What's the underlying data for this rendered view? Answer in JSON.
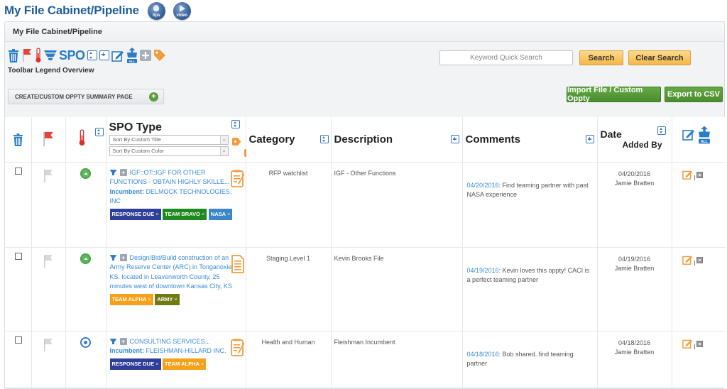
{
  "page": {
    "title": "My File Cabinet/Pipeline",
    "tips_label": "tips",
    "video_label": "video"
  },
  "panel": {
    "title": "My File Cabinet/Pipeline",
    "toolbar": {
      "spo_label": "SPO",
      "legend_label": "Toolbar Legend Overview",
      "icons": [
        "trash-icon",
        "flag-icon",
        "thermometer-icon",
        "funnel-icon",
        "spo-text",
        "sort-icon",
        "plus-icon",
        "edit-icon",
        "share-all-icon",
        "grey-plus-icon",
        "tag-icon"
      ]
    },
    "search": {
      "placeholder": "Keyword Quick Search",
      "value": "",
      "search_label": "Search",
      "clear_label": "Clear Search"
    },
    "create_button_label": "CREATE/CUSTOM OPPTY SUMMARY PAGE",
    "import_label": "Import File / Custom Oppty",
    "export_label": "Export to CSV"
  },
  "table": {
    "headers": {
      "spo_type": "SPO Type",
      "sort_title": "Sort By Custom Title",
      "sort_color": "Sort By Custom Color",
      "category": "Category",
      "description": "Description",
      "comments": "Comments",
      "date": "Date",
      "added_by": "Added By",
      "all_badge": "ALL"
    },
    "rows": [
      {
        "temperature": "up",
        "spo_title": "IGF::OT::IGF FOR OTHER FUNCTIONS - OBTAIN HIGHLY SKILLE...",
        "incumbent_label": "Incumbent:",
        "incumbent": "DELMOCK TECHNOLOGIES, INC",
        "tags": [
          {
            "label": "RESPONSE DUE",
            "color": "#2f3f99"
          },
          {
            "label": "TEAM BRAVO",
            "color": "#1e8a1e"
          },
          {
            "label": "NASA",
            "color": "#3a86c8"
          }
        ],
        "category": "RFP watchlist",
        "description": "IGF - Other Functions",
        "comment_date": "04/20/2016",
        "comment_text": ": Find teaming partner with past NASA experience",
        "date": "04/20/2016",
        "added_by": "Jamie Bratten"
      },
      {
        "temperature": "up",
        "spo_title": "Design/Bid/Build construction of an Army Reserve Center (ARC) in Tonganoxie, KS. located in Leavenworth County, 25 minutes west of downtown Kansas City, KS",
        "incumbent_label": "",
        "incumbent": "",
        "tags": [
          {
            "label": "TEAM ALPHA",
            "color": "#f5a21a"
          },
          {
            "label": "ARMY",
            "color": "#6f7a14"
          }
        ],
        "category": "Staging Level 1",
        "description": "Kevin Brooks File",
        "comment_date": "04/19/2016",
        "comment_text": ": Kevin loves this oppty! CACI is a perfect teaming partner",
        "date": "04/19/2016",
        "added_by": "Jamie Bratten"
      },
      {
        "temperature": "target",
        "spo_title": "CONSULTING SERVICES...",
        "incumbent_label": "Incumbent:",
        "incumbent": "FLEISHMAN-HILLARD INC.",
        "tags": [
          {
            "label": "RESPONSE DUE",
            "color": "#2f3f99"
          },
          {
            "label": "TEAM ALPHA",
            "color": "#f5a21a"
          }
        ],
        "category": "Health and Human",
        "description": "Fleishman Incumbent",
        "comment_date": "04/18/2016",
        "comment_text": ": Bob shared..find teaming partner",
        "date": "04/18/2016",
        "added_by": "Jamie Bratten"
      }
    ]
  },
  "colors": {
    "title_blue": "#1f5d98",
    "link_blue": "#3a8bd6",
    "accent_orange": "#f39c3d",
    "button_yellow": "#f4b748",
    "button_green": "#4a8d30"
  }
}
